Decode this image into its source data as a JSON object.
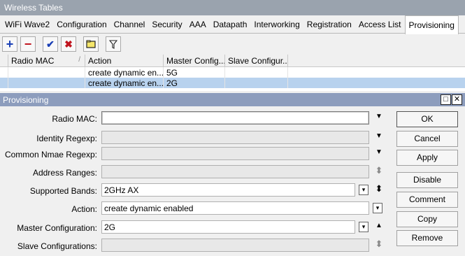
{
  "window": {
    "title": "Wireless Tables"
  },
  "tabs": [
    "WiFi Wave2",
    "Configuration",
    "Channel",
    "Security",
    "AAA",
    "Datapath",
    "Interworking",
    "Registration",
    "Access List",
    "Provisioning"
  ],
  "toolbar": {
    "add": "+",
    "remove": "−",
    "enable": "✔",
    "disable": "✖",
    "comment": "□",
    "filter": "⊽"
  },
  "grid": {
    "headers": [
      "Radio MAC",
      "Action",
      "Master Config...",
      "Slave Configur..."
    ],
    "sort_marker": "/",
    "rows": [
      {
        "radio_mac": "",
        "action": "create dynamic en...",
        "master": "5G",
        "slave": ""
      },
      {
        "radio_mac": "",
        "action": "create dynamic en...",
        "master": "2G",
        "slave": ""
      }
    ]
  },
  "dialog": {
    "title": "Provisioning",
    "restore": "□",
    "close": "✕",
    "fields": {
      "radio_mac": {
        "label": "Radio MAC:",
        "value": ""
      },
      "identity_regexp": {
        "label": "Identity Regexp:",
        "value": ""
      },
      "common_name_regexp": {
        "label": "Common Nmae Regexp:",
        "value": ""
      },
      "address_ranges": {
        "label": "Address Ranges:",
        "value": ""
      },
      "supported_bands": {
        "label": "Supported Bands:",
        "value": "2GHz AX"
      },
      "action": {
        "label": "Action:",
        "value": "create dynamic enabled"
      },
      "master_configuration": {
        "label": "Master Configuration:",
        "value": "2G"
      },
      "slave_configurations": {
        "label": "Slave Configurations:",
        "value": ""
      }
    },
    "buttons": {
      "ok": "OK",
      "cancel": "Cancel",
      "apply": "Apply",
      "disable": "Disable",
      "comment": "Comment",
      "copy": "Copy",
      "remove": "Remove"
    },
    "glyphs": {
      "down": "▼",
      "up": "▲",
      "updown": "⬍",
      "box_down": "▾"
    }
  }
}
